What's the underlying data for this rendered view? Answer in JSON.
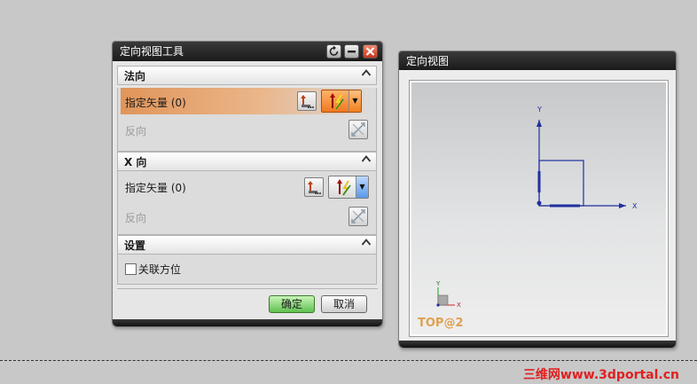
{
  "dialog": {
    "title": "定向视图工具",
    "normal_section": {
      "header": "法向",
      "specify_vector": "指定矢量 (0)",
      "reverse": "反向"
    },
    "x_section": {
      "header": "X 向",
      "specify_vector": "指定矢量 (0)",
      "reverse": "反向"
    },
    "settings_section": {
      "header": "设置",
      "associative": "关联方位",
      "associative_checked": false
    },
    "ok_label": "确定",
    "cancel_label": "取消"
  },
  "view_window": {
    "title": "定向视图",
    "view_name": "TOP@2",
    "triad": {
      "y_label": "Y",
      "x_label": "X"
    },
    "mini_triad": {
      "y_label": "Y",
      "x_label": "X"
    }
  },
  "watermark": "三维网www.3dportal.cn",
  "colors": {
    "title_bar": "#1a1a1a",
    "active_row": "#e0955a",
    "ok_button": "#60c050",
    "axis_blue": "#2030a0",
    "view_name": "#e0a050",
    "watermark": "#e02020"
  },
  "icons": [
    "reload-icon",
    "minimize-icon",
    "close-icon",
    "collapse-icon",
    "vector-dialog-icon",
    "inferred-vector-icon",
    "dropdown-arrow-icon",
    "reverse-direction-icon"
  ]
}
